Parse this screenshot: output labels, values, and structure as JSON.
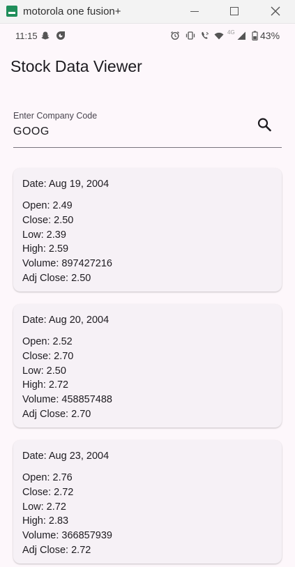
{
  "window": {
    "title": "motorola one fusion+"
  },
  "status_bar": {
    "time": "11:15",
    "network": "4G",
    "battery": "43%"
  },
  "app_bar": {
    "title": "Stock Data Viewer"
  },
  "search": {
    "label": "Enter Company Code",
    "value": "GOOG"
  },
  "records": [
    {
      "date": "Date: Aug 19, 2004",
      "open": "Open: 2.49",
      "close": "Close: 2.50",
      "low": "Low: 2.39",
      "high": "High: 2.59",
      "volume": "Volume: 897427216",
      "adj_close": "Adj Close: 2.50"
    },
    {
      "date": "Date: Aug 20, 2004",
      "open": "Open: 2.52",
      "close": "Close: 2.70",
      "low": "Low: 2.50",
      "high": "High: 2.72",
      "volume": "Volume: 458857488",
      "adj_close": "Adj Close: 2.70"
    },
    {
      "date": "Date: Aug 23, 2004",
      "open": "Open: 2.76",
      "close": "Close: 2.72",
      "low": "Low: 2.72",
      "high": "High: 2.83",
      "volume": "Volume: 366857939",
      "adj_close": "Adj Close: 2.72"
    }
  ]
}
